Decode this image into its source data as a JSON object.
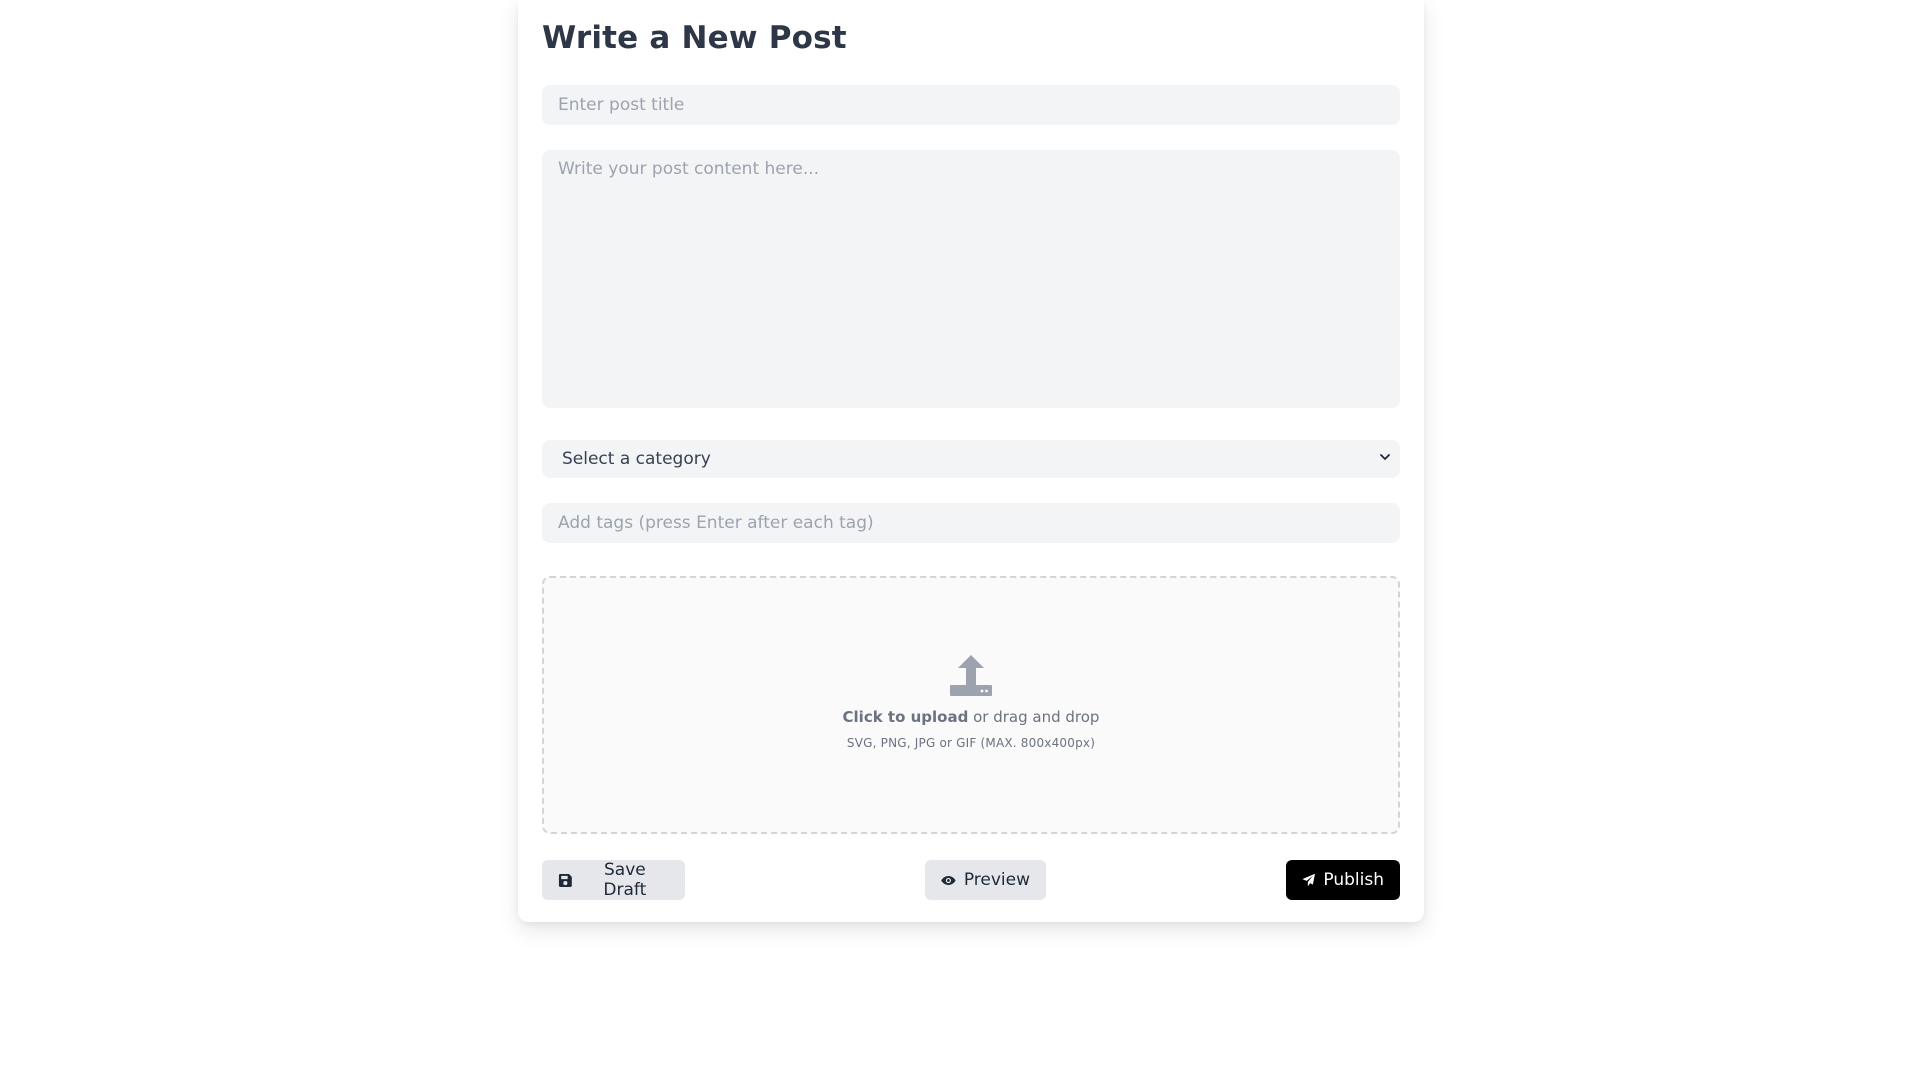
{
  "page_title": "Write a New Post",
  "title_input": {
    "placeholder": "Enter post title",
    "value": ""
  },
  "content_area": {
    "placeholder": "Write your post content here...",
    "value": ""
  },
  "category_select": {
    "selected": "Select a category"
  },
  "tags_input": {
    "placeholder": "Add tags (press Enter after each tag)",
    "value": ""
  },
  "upload": {
    "icon": "upload-icon",
    "click_text": "Click to upload",
    "drag_text": " or drag and drop",
    "hint": "SVG, PNG, JPG or GIF (MAX. 800x400px)"
  },
  "actions": {
    "save_draft": {
      "label": "Save Draft",
      "icon": "save-icon"
    },
    "preview": {
      "label": "Preview",
      "icon": "eye-icon"
    },
    "publish": {
      "label": "Publish",
      "icon": "paper-plane-icon"
    }
  },
  "colors": {
    "field_bg": "#f3f4f6",
    "secondary_button_bg": "#e5e7eb",
    "primary_button_bg": "#000000",
    "placeholder": "#9ca3af"
  }
}
